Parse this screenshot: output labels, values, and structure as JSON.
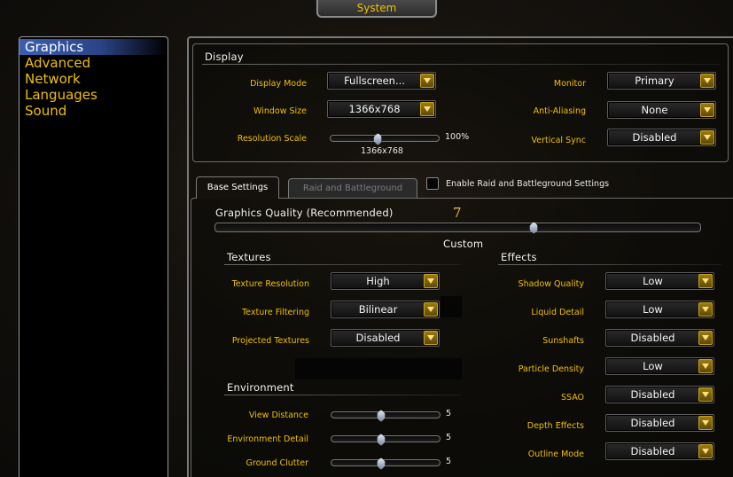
{
  "window": {
    "title": "System"
  },
  "categories": [
    "Graphics",
    "Advanced",
    "Network",
    "Languages",
    "Sound"
  ],
  "display": {
    "heading": "Display",
    "display_mode_label": "Display Mode",
    "display_mode_value": "Fullscreen...",
    "window_size_label": "Window Size",
    "window_size_value": "1366x768",
    "resolution_scale_label": "Resolution Scale",
    "resolution_scale_pct": "100%",
    "resolution_scale_sub": "1366x768",
    "resolution_scale_fraction": 0.43,
    "monitor_label": "Monitor",
    "monitor_value": "Primary",
    "anti_aliasing_label": "Anti-Aliasing",
    "anti_aliasing_value": "None",
    "vsync_label": "Vertical Sync",
    "vsync_value": "Disabled"
  },
  "tabs": {
    "base": "Base Settings",
    "raid": "Raid and Battleground",
    "enable_raid_label": "Enable Raid and Battleground Settings"
  },
  "quality": {
    "label": "Graphics Quality (Recommended)",
    "value": "7",
    "custom": "Custom",
    "fraction": 0.655
  },
  "textures": {
    "heading": "Textures",
    "resolution_label": "Texture Resolution",
    "resolution_value": "High",
    "filtering_label": "Texture Filtering",
    "filtering_value": "Bilinear",
    "projected_label": "Projected Textures",
    "projected_value": "Disabled"
  },
  "environment": {
    "heading": "Environment",
    "view_distance_label": "View Distance",
    "view_distance_value": "5",
    "detail_label": "Environment Detail",
    "detail_value": "5",
    "clutter_label": "Ground Clutter",
    "clutter_value": "5",
    "slider_fraction": 0.45
  },
  "effects": {
    "heading": "Effects",
    "shadow_label": "Shadow Quality",
    "shadow_value": "Low",
    "liquid_label": "Liquid Detail",
    "liquid_value": "Low",
    "sunshafts_label": "Sunshafts",
    "sunshafts_value": "Disabled",
    "particle_label": "Particle Density",
    "particle_value": "Low",
    "ssao_label": "SSAO",
    "ssao_value": "Disabled",
    "depth_label": "Depth Effects",
    "depth_value": "Disabled",
    "outline_label": "Outline Mode",
    "outline_value": "Disabled"
  },
  "colors": {
    "gold": "#f0c000",
    "selected": "#3b5fb0"
  }
}
